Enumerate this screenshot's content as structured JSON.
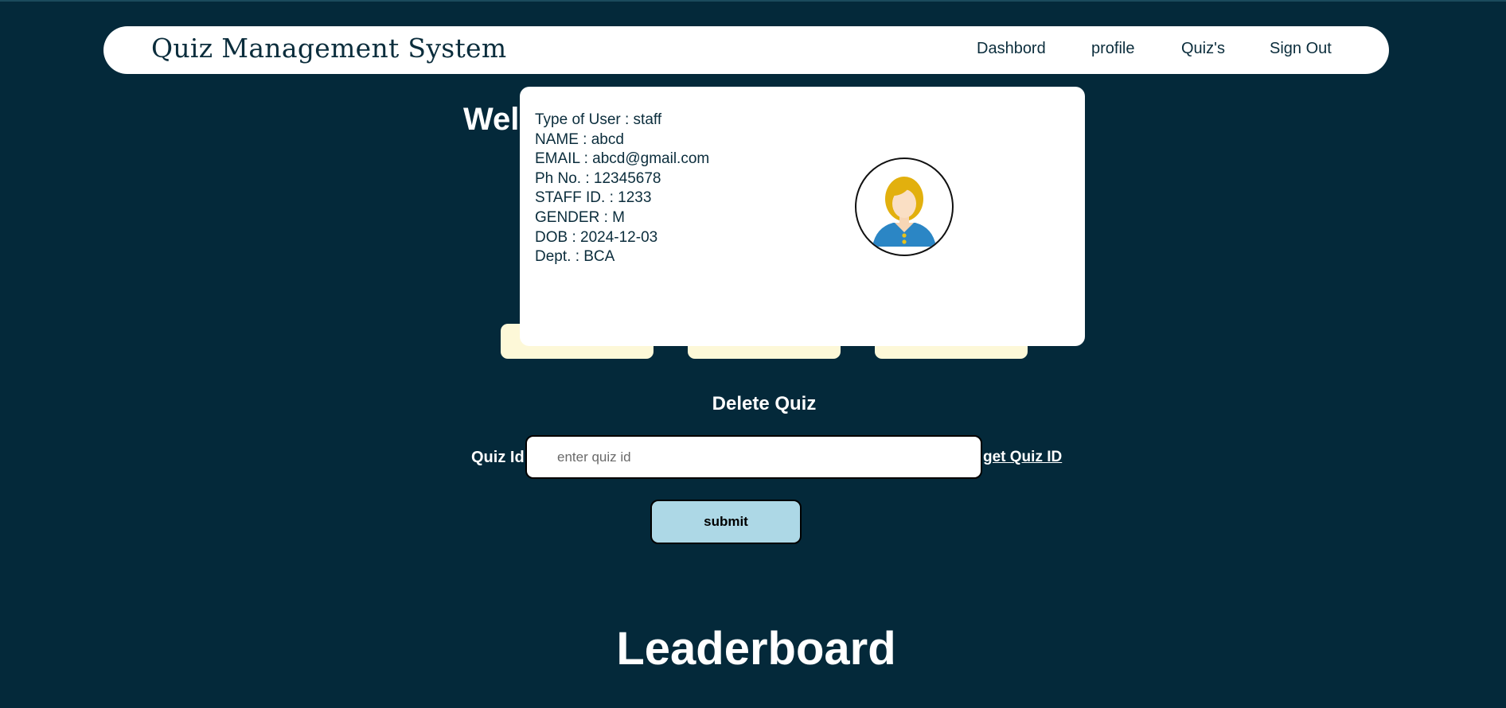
{
  "navbar": {
    "brand": "Quiz Management System",
    "links": [
      "Dashbord",
      "profile",
      "Quiz's",
      "Sign Out"
    ]
  },
  "welcome": "Welc",
  "profile_popup": {
    "lines": [
      "Type of User : staff",
      "NAME : abcd",
      "EMAIL : abcd@gmail.com",
      "Ph No. : 12345678",
      "STAFF ID. : 1233",
      "GENDER : M",
      "DOB : 2024-12-03",
      "Dept. : BCA"
    ],
    "avatar_icon": "user-avatar-icon"
  },
  "delete_quiz": {
    "title": "Delete Quiz",
    "label": "Quiz Id",
    "placeholder": "enter quiz id",
    "value": "",
    "link": "get Quiz ID",
    "submit": "submit"
  },
  "leaderboard": "Leaderboard",
  "colors": {
    "background": "#04293a",
    "navbar": "#ffffff",
    "card": "#fdf8d8",
    "submit": "#add8e6"
  }
}
